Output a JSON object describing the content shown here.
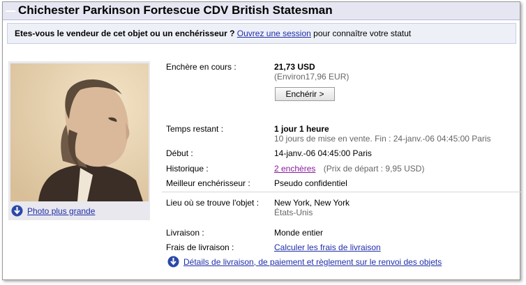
{
  "listing": {
    "title": "Chichester Parkinson Fortescue CDV British Statesman"
  },
  "notice": {
    "question": "Etes-vous le vendeur de cet objet ou un enchérisseur ?",
    "link": "Ouvrez une session",
    "suffix": "pour connaître votre statut"
  },
  "photo": {
    "link": "Photo plus grande"
  },
  "details": {
    "current_bid_label": "Enchère en cours :",
    "current_bid_value": "21,73 USD",
    "current_bid_converted": "(Environ17,96 EUR)",
    "bid_button": "Enchérir >",
    "time_left_label": "Temps restant :",
    "time_left_value": "1 jour 1 heure",
    "time_left_note": "10 jours de mise en vente. Fin : 24-janv.-06 04:45:00 Paris",
    "start_label": "Début :",
    "start_value": "14-janv.-06 04:45:00 Paris",
    "history_label": "Historique :",
    "history_link": "2 enchères",
    "history_note": "(Prix de départ : 9,95 USD)",
    "high_bidder_label": "Meilleur enchérisseur :",
    "high_bidder_value": "Pseudo confidentiel",
    "location_label": "Lieu où se trouve l'objet :",
    "location_value": "New York, New York",
    "location_country": "États-Unis",
    "ships_label": "Livraison :",
    "ships_value": "Monde entier",
    "shipping_cost_label": "Frais de livraison :",
    "shipping_cost_link": "Calculer les frais de livraison",
    "details_link": "Détails de livraison, de paiement et règlement sur le renvoi des objets"
  },
  "icons": {
    "download": "down-arrow-circle-icon"
  },
  "colors": {
    "link": "#1f2ea8",
    "visited_link": "#8a1a9e",
    "title_bar": "#e6e6f2",
    "notice_bg": "#eef0f8"
  }
}
